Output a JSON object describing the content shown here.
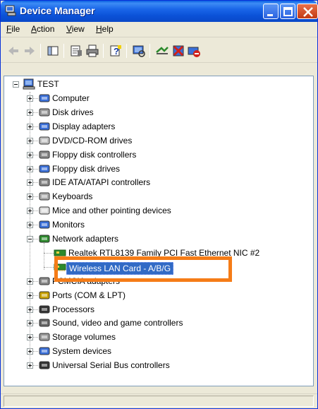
{
  "window": {
    "title": "Device Manager"
  },
  "menu": {
    "items": [
      {
        "label_prefix": "",
        "label_ul": "F",
        "label_rest": "ile"
      },
      {
        "label_prefix": "",
        "label_ul": "A",
        "label_rest": "ction"
      },
      {
        "label_prefix": "",
        "label_ul": "V",
        "label_rest": "iew"
      },
      {
        "label_prefix": "",
        "label_ul": "H",
        "label_rest": "elp"
      }
    ]
  },
  "toolbar": {
    "icons": [
      "back-arrow-icon",
      "forward-arrow-icon",
      "show-hide-console-tree-icon",
      "properties-icon",
      "print-icon",
      "help-icon",
      "scan-hardware-icon",
      "update-driver-icon",
      "uninstall-icon",
      "disable-icon"
    ]
  },
  "tree": {
    "root": "TEST",
    "categories": [
      {
        "label": "Computer"
      },
      {
        "label": "Disk drives"
      },
      {
        "label": "Display adapters"
      },
      {
        "label": "DVD/CD-ROM drives"
      },
      {
        "label": "Floppy disk controllers"
      },
      {
        "label": "Floppy disk drives"
      },
      {
        "label": "IDE ATA/ATAPI controllers"
      },
      {
        "label": "Keyboards"
      },
      {
        "label": "Mice and other pointing devices"
      },
      {
        "label": "Monitors"
      },
      {
        "label": "Network adapters"
      }
    ],
    "network_children": [
      {
        "label": "Realtek RTL8139 Family PCI Fast Ethernet NIC #2"
      },
      {
        "label": "Wireless LAN Card - A/B/G"
      }
    ],
    "categories_after": [
      {
        "label": "PCMCIA adapters"
      },
      {
        "label": "Ports (COM & LPT)"
      },
      {
        "label": "Processors"
      },
      {
        "label": "Sound, video and game controllers"
      },
      {
        "label": "Storage volumes"
      },
      {
        "label": "System devices"
      },
      {
        "label": "Universal Serial Bus controllers"
      }
    ]
  },
  "colors": {
    "titlebar": "#0b52d8",
    "selection": "#316ac5",
    "highlight_box": "#f57c17"
  }
}
